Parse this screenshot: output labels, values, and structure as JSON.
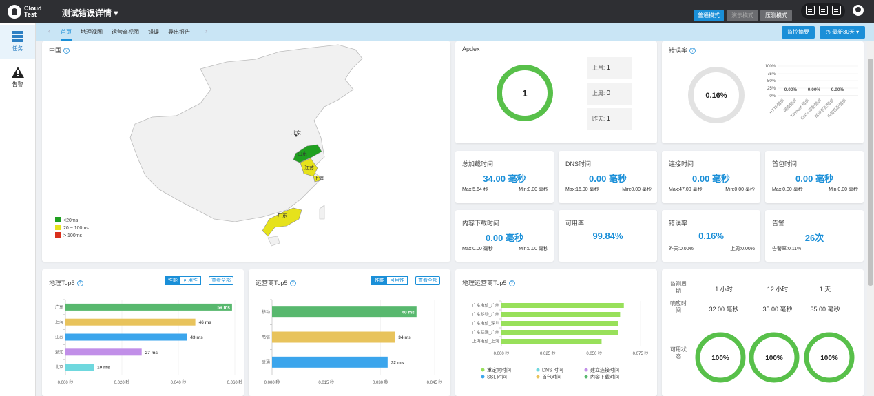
{
  "header": {
    "logo_text": "Cloud Test",
    "title": "测试错误详情",
    "modes": [
      "普通模式",
      "演示模式",
      "压测模式"
    ],
    "colors": {
      "bar": "#2e2f33",
      "accent": "#1a8fd8"
    }
  },
  "sidebar": {
    "items": [
      {
        "label": "任务",
        "icon": "task-list-icon"
      },
      {
        "label": "告警",
        "icon": "warning-icon"
      }
    ]
  },
  "subnav": {
    "tabs": [
      "首页",
      "地理视图",
      "运营商视图",
      "错误",
      "导出报告"
    ],
    "summary_button": "监控摘要",
    "range_button": "最新30天"
  },
  "map_panel": {
    "title": "中国",
    "region_labels": [
      "北京",
      "山东",
      "江苏",
      "上海",
      "广东"
    ],
    "legend": [
      {
        "label": "<20ms",
        "color": "#20a020"
      },
      {
        "label": "20 ~ 100ms",
        "color": "#e6e21c"
      },
      {
        "label": "> 100ms",
        "color": "#d9301c"
      }
    ]
  },
  "apdex": {
    "title": "Apdex",
    "value": "1",
    "items": [
      {
        "label": "上月:",
        "value": "1"
      },
      {
        "label": "上周:",
        "value": "0"
      },
      {
        "label": "昨天:",
        "value": "1"
      }
    ]
  },
  "error_rate": {
    "title": "错误率",
    "value": "0.16%",
    "bar_labels": [
      "0.00%",
      "0.00%",
      "0.00%"
    ],
    "y_ticks": [
      "100%",
      "75%",
      "50%",
      "25%",
      "0%"
    ],
    "categories": [
      "HTTP错误",
      "网络错误",
      "Timeout 错误",
      "Code 匹配错误",
      "时间匹配错误",
      "内容匹配错误"
    ]
  },
  "metrics": [
    {
      "title": "总加载时间",
      "value": "34.00 毫秒",
      "max": "Max:5.64 秒",
      "min": "Min:0.00 毫秒"
    },
    {
      "title": "DNS时间",
      "value": "0.00 毫秒",
      "max": "Max:16.00 毫秒",
      "min": "Min:0.00 毫秒"
    },
    {
      "title": "连接时间",
      "value": "0.00 毫秒",
      "max": "Max:47.00 毫秒",
      "min": "Min:0.00 毫秒"
    },
    {
      "title": "首包时间",
      "value": "0.00 毫秒",
      "max": "Max:0.00 毫秒",
      "min": "Min:0.00 毫秒"
    },
    {
      "title": "内容下载时间",
      "value": "0.00 毫秒",
      "max": "Max:0.00 毫秒",
      "min": "Min:0.00 毫秒"
    },
    {
      "title": "可用率",
      "value": "99.84%",
      "max": "",
      "min": ""
    },
    {
      "title": "错误率",
      "value": "0.16%",
      "max": "昨天:0.00%",
      "min": "上周:0.00%"
    },
    {
      "title": "告警",
      "value": "26次",
      "max": "告警率:0.11%",
      "min": ""
    }
  ],
  "geo_top5": {
    "title": "地理Top5",
    "toggle": [
      "性能",
      "可用性"
    ],
    "view_all": "查看全部",
    "colors": [
      "#58b86e",
      "#e8c35c",
      "#3ba5ec",
      "#c18fe8",
      "#6fd8de"
    ],
    "chart_data": {
      "type": "bar",
      "categories": [
        "广东",
        "上海",
        "江苏",
        "浙江",
        "北京"
      ],
      "values": [
        59,
        46,
        43,
        27,
        10
      ],
      "value_labels": [
        "59 ms",
        "46 ms",
        "43 ms",
        "27 ms",
        "10 ms"
      ],
      "x_ticks": [
        "0.000 秒",
        "0.020 秒",
        "0.040 秒",
        "0.060 秒"
      ],
      "xlim": [
        0,
        60
      ]
    }
  },
  "isp_top5": {
    "title": "运营商Top5",
    "toggle": [
      "性能",
      "可用性"
    ],
    "view_all": "查看全部",
    "colors": [
      "#58b86e",
      "#e8c35c",
      "#3ba5ec"
    ],
    "chart_data": {
      "type": "bar",
      "categories": [
        "移动",
        "电信",
        "联通"
      ],
      "values": [
        40,
        34,
        32
      ],
      "value_labels": [
        "40 ms",
        "34 ms",
        "32 ms"
      ],
      "x_ticks": [
        "0.000 秒",
        "0.015 秒",
        "0.030 秒",
        "0.045 秒"
      ],
      "xlim": [
        0,
        45
      ]
    }
  },
  "geo_isp_top5": {
    "title": "地理运营商Top5",
    "color": "#98e05a",
    "chart_data": {
      "type": "bar",
      "categories": [
        "广东电信_广州",
        "广东移动_广州",
        "广东电信_深圳",
        "广东联通_广州",
        "上海电信_上海"
      ],
      "values": [
        0.066,
        0.064,
        0.063,
        0.063,
        0.054
      ],
      "x_ticks": [
        "0.000 秒",
        "0.025 秒",
        "0.050 秒",
        "0.075 秒"
      ],
      "xlim": [
        0,
        0.075
      ]
    },
    "legend": [
      {
        "label": "重定向时间",
        "color": "#98e05a"
      },
      {
        "label": "DNS 时间",
        "color": "#6fd8de"
      },
      {
        "label": "建立连接时间",
        "color": "#c18fe8"
      },
      {
        "label": "SSL 时间",
        "color": "#3ba5ec"
      },
      {
        "label": "首包时间",
        "color": "#e8c35c"
      },
      {
        "label": "内容下载时间",
        "color": "#58b86e"
      }
    ]
  },
  "periods": {
    "row_labels": [
      "监测周期",
      "响应时间",
      "可用状态"
    ],
    "columns": [
      "1 小时",
      "12 小时",
      "1 天"
    ],
    "response": [
      "32.00 毫秒",
      "35.00 毫秒",
      "35.00 毫秒"
    ],
    "availability": [
      "100%",
      "100%",
      "100%"
    ]
  }
}
